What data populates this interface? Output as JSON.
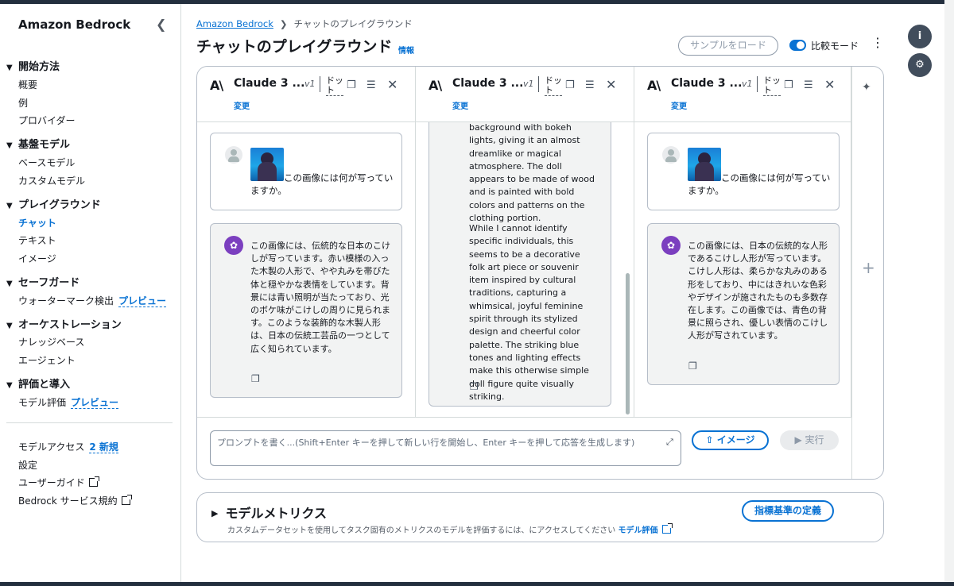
{
  "sidebar": {
    "title": "Amazon Bedrock",
    "sections": [
      {
        "label": "開始方法",
        "items": [
          "概要",
          "例",
          "プロバイダー"
        ]
      },
      {
        "label": "基盤モデル",
        "items": [
          "ベースモデル",
          "カスタムモデル"
        ]
      },
      {
        "label": "プレイグラウンド",
        "items": [
          "チャット",
          "テキスト",
          "イメージ"
        ]
      },
      {
        "label": "セーフガード",
        "items": [
          "ウォーターマーク検出"
        ]
      },
      {
        "label": "オーケストレーション",
        "items": [
          "ナレッジベース",
          "エージェント"
        ]
      },
      {
        "label": "評価と導入",
        "items": [
          "モデル評価"
        ]
      }
    ],
    "preview_label": "プレビュー",
    "bottom": {
      "model_access": "モデルアクセス",
      "model_access_badge": "2 新規",
      "settings": "設定",
      "user_guide": "ユーザーガイド",
      "terms": "Bedrock サービス規約"
    }
  },
  "header": {
    "breadcrumb_root": "Amazon Bedrock",
    "breadcrumb_current": "チャットのプレイグラウンド",
    "title": "チャットのプレイグラウンド",
    "info": "情報",
    "load_sample": "サンプルをロード",
    "compare_mode": "比較モード"
  },
  "columns": [
    {
      "model_name": "Claude 3 ...",
      "version": "v1",
      "dot": "ドット",
      "change": "変更"
    },
    {
      "model_name": "Claude 3 ...",
      "version": "v1",
      "dot": "ドット",
      "change": "変更"
    },
    {
      "model_name": "Claude 3 ...",
      "version": "v1",
      "dot": "ドット",
      "change": "変更"
    }
  ],
  "chat": {
    "user_prompt": "この画像には何が写っていますか。",
    "col1_answer": "この画像には、伝統的な日本のこけしが写っています。赤い模様の入った木製の人形で、やや丸みを帯びた体と穏やかな表情をしています。背景には青い照明が当たっており、光のボケ味がこけしの周りに見られます。このような装飾的な木製人形は、日本の伝統工芸品の一つとして広く知られています。",
    "col2_para1": "background with bokeh lights, giving it an almost dreamlike or magical atmosphere. The doll appears to be made of wood and is painted with bold colors and patterns on the clothing portion.",
    "col2_para2": "While I cannot identify specific individuals, this seems to be a decorative folk art piece or souvenir item inspired by cultural traditions, capturing a whimsical, joyful feminine spirit through its stylized design and cheerful color palette. The striking blue tones and lighting effects make this otherwise simple doll figure quite visually striking.",
    "col3_answer": "この画像には、日本の伝統的な人形であるこけし人形が写っています。こけし人形は、柔らかな丸みのある形をしており、中にはきれいな色彩やデザインが施されたものも多数存在します。この画像では、青色の背景に照らされ、優しい表情のこけし人形が写されています。"
  },
  "prompt": {
    "placeholder": "プロンプトを書く...(Shift+Enter キーを押して新しい行を開始し、Enter キーを押して応答を生成します)",
    "image_button": "イメージ",
    "run_button": "実行"
  },
  "metrics": {
    "title": "モデルメトリクス",
    "description": "カスタムデータセットを使用してタスク固有のメトリクスのモデルを評価するには、にアクセスしてください",
    "link": "モデル評価",
    "button": "指標基準の定義"
  },
  "icons": {
    "collapse": "chevron-left-icon",
    "info": "info-icon",
    "settings": "gear-icon",
    "copy": "copy-icon",
    "tune": "sliders-icon",
    "close": "close-icon",
    "clear": "broom-icon",
    "add": "plus-icon",
    "expand": "expand-icon"
  },
  "colors": {
    "accent": "#0972d3",
    "nav_dark": "#232f3e",
    "ai_avatar": "#7b3fbf"
  }
}
